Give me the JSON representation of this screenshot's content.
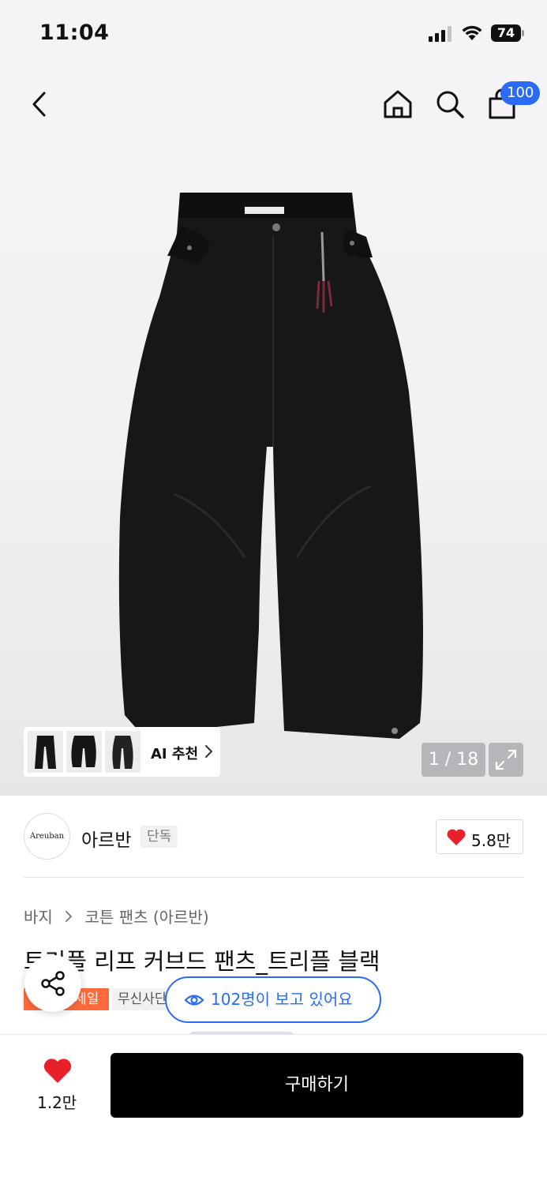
{
  "status_bar": {
    "time": "11:04",
    "battery": "74"
  },
  "header": {
    "cart_count": "100"
  },
  "gallery": {
    "ai_recommend_label": "AI 추천",
    "page_counter": "1 / 18"
  },
  "brand": {
    "logo_text": "Areuban",
    "name": "아르반",
    "tag": "단독",
    "like_count": "5.8만"
  },
  "breadcrumb": {
    "category": "바지",
    "subcategory": "코튼 팬츠 (아르반)"
  },
  "product": {
    "title": "트리플 리프 커브드 팬츠_트리플 블랙",
    "tags": [
      "세일",
      "무신사단"
    ]
  },
  "viewers": {
    "text": "102명이 보고 있어요"
  },
  "bottom_bar": {
    "wish_count": "1.2만",
    "buy_label": "구매하기"
  },
  "colors": {
    "accent_blue": "#2a6cf5",
    "sale_orange": "#ff6a3d",
    "heart_red": "#e8202a",
    "buy_black": "#000000"
  }
}
